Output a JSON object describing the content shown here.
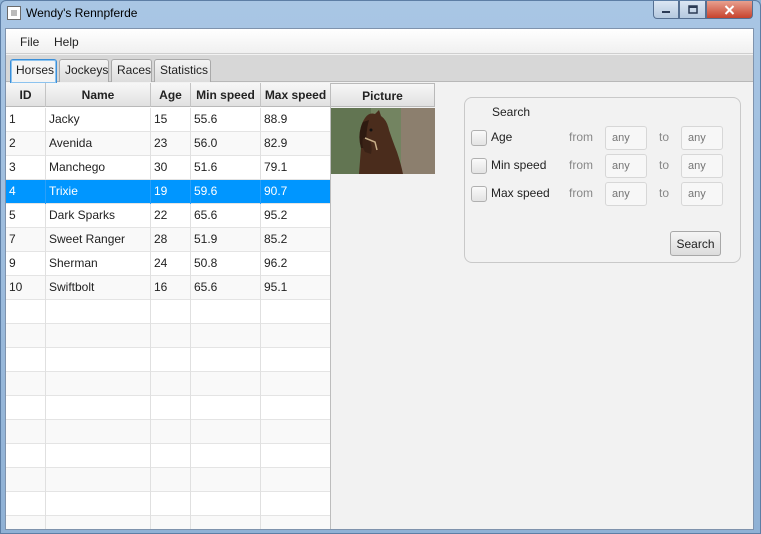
{
  "window": {
    "title": "Wendy's Rennpferde",
    "minimize_icon": "minimize-icon",
    "maximize_icon": "maximize-icon",
    "close_icon": "close-icon"
  },
  "menubar": {
    "file_label": "File",
    "help_label": "Help"
  },
  "tabs": [
    {
      "label": "Horses",
      "selected": true
    },
    {
      "label": "Jockeys",
      "selected": false
    },
    {
      "label": "Races",
      "selected": false
    },
    {
      "label": "Statistics",
      "selected": false
    }
  ],
  "table": {
    "columns": [
      "ID",
      "Name",
      "Age",
      "Min speed",
      "Max speed"
    ],
    "rows": [
      {
        "id": "1",
        "name": "Jacky",
        "age": "15",
        "min": "55.6",
        "max": "88.9"
      },
      {
        "id": "2",
        "name": "Avenida",
        "age": "23",
        "min": "56.0",
        "max": "82.9"
      },
      {
        "id": "3",
        "name": "Manchego",
        "age": "30",
        "min": "51.6",
        "max": "79.1"
      },
      {
        "id": "4",
        "name": "Trixie",
        "age": "19",
        "min": "59.6",
        "max": "90.7"
      },
      {
        "id": "5",
        "name": "Dark Sparks",
        "age": "22",
        "min": "65.6",
        "max": "95.2"
      },
      {
        "id": "7",
        "name": "Sweet Ranger",
        "age": "28",
        "min": "51.9",
        "max": "85.2"
      },
      {
        "id": "9",
        "name": "Sherman",
        "age": "24",
        "min": "50.8",
        "max": "96.2"
      },
      {
        "id": "10",
        "name": "Swiftbolt",
        "age": "16",
        "min": "65.6",
        "max": "95.1"
      }
    ],
    "selected_row_index": 3,
    "selection_color": "#0096ff"
  },
  "picture": {
    "header": "Picture",
    "image": "horse-photo"
  },
  "search": {
    "legend": "Search",
    "rows": [
      {
        "label": "Age",
        "from": "from",
        "to": "to",
        "from_placeholder": "any",
        "to_placeholder": "any"
      },
      {
        "label": "Min speed",
        "from": "from",
        "to": "to",
        "from_placeholder": "any",
        "to_placeholder": "any"
      },
      {
        "label": "Max speed",
        "from": "from",
        "to": "to",
        "from_placeholder": "any",
        "to_placeholder": "any"
      }
    ],
    "button_label": "Search"
  }
}
